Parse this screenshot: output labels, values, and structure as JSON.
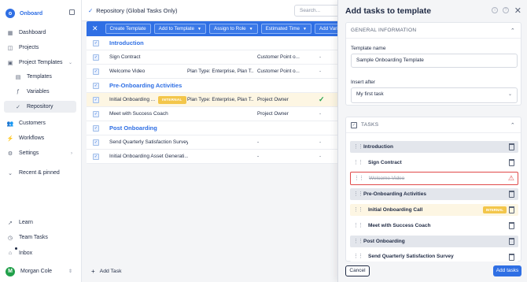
{
  "sidebar": {
    "brand": "Onboard",
    "items": [
      {
        "label": "Dashboard",
        "icon": "grid-icon"
      },
      {
        "label": "Projects",
        "icon": "map-icon"
      },
      {
        "label": "Project Templates",
        "icon": "template-icon"
      },
      {
        "label": "Templates",
        "icon": "table-icon"
      },
      {
        "label": "Variables",
        "icon": "variable-icon"
      },
      {
        "label": "Repository",
        "icon": "check-icon"
      },
      {
        "label": "Customers",
        "icon": "users-icon"
      },
      {
        "label": "Workflows",
        "icon": "bolt-icon"
      },
      {
        "label": "Settings",
        "icon": "gear-icon"
      },
      {
        "label": "Recent & pinned",
        "icon": "chevron-icon"
      },
      {
        "label": "Learn",
        "icon": "rocket-icon"
      },
      {
        "label": "Team Tasks",
        "icon": "task-icon"
      },
      {
        "label": "Inbox",
        "icon": "inbox-icon"
      }
    ],
    "user": {
      "initial": "M",
      "name": "Morgan Cole"
    }
  },
  "main": {
    "breadcrumb": "Repository (Global Tasks Only)",
    "search_placeholder": "Search...",
    "toolbar": {
      "create_template": "Create Template",
      "add_to_template": "Add to Template",
      "assign_to_role": "Assign to Role",
      "estimated_time": "Estimated Time",
      "add_variable": "Add Variab"
    },
    "rows": [
      {
        "type": "section",
        "name": "Introduction"
      },
      {
        "type": "task",
        "name": "Sign Contract",
        "plan": "",
        "role": "Customer Point o...",
        "est": "-"
      },
      {
        "type": "task",
        "name": "Welcome Video",
        "plan": "Plan Type: Enterprise, Plan T...",
        "role": "Customer Point o...",
        "est": "-"
      },
      {
        "type": "section",
        "name": "Pre-Onboarding Activities"
      },
      {
        "type": "task",
        "name": "Initial Onboarding ...",
        "badge": "INTERNAL",
        "plan": "Plan Type: Enterprise, Plan T...",
        "role": "Project Owner",
        "est": "",
        "highlight": true
      },
      {
        "type": "task",
        "name": "Meet with Success Coach",
        "plan": "",
        "role": "Project Owner",
        "est": "-"
      },
      {
        "type": "section",
        "name": "Post Onboarding"
      },
      {
        "type": "task",
        "name": "Send Quarterly Satisfaction Survey",
        "plan": "",
        "role": "-",
        "est": "-"
      },
      {
        "type": "task",
        "name": "Initial Onboarding Asset Generati...",
        "plan": "",
        "role": "-",
        "est": "-"
      }
    ],
    "add_task": "Add Task"
  },
  "panel": {
    "title": "Add tasks to template",
    "general_header": "GENERAL INFORMATION",
    "template_name_label": "Template name",
    "template_name_value": "Sample Onboarding Template",
    "insert_after_label": "Insert after",
    "insert_after_value": "My first task",
    "tasks_header": "TASKS",
    "tasks": [
      {
        "kind": "sec",
        "name": "Introduction"
      },
      {
        "kind": "task",
        "name": "Sign Contract"
      },
      {
        "kind": "err",
        "name": "Welcome Video"
      },
      {
        "kind": "sec",
        "name": "Pre-Onboarding Activities"
      },
      {
        "kind": "hl",
        "name": "Initial Onboarding Call",
        "badge": "INTERNAL"
      },
      {
        "kind": "task",
        "name": "Meet with Success Coach"
      },
      {
        "kind": "sec",
        "name": "Post Onboarding"
      },
      {
        "kind": "task",
        "name": "Send Quarterly Satisfaction Survey"
      }
    ],
    "cancel": "Cancel",
    "add_tasks": "Add tasks"
  },
  "colors": {
    "accent": "#2f6fe4",
    "internal": "#f3c64a",
    "error": "#e04a4a",
    "success": "#21a04a"
  }
}
